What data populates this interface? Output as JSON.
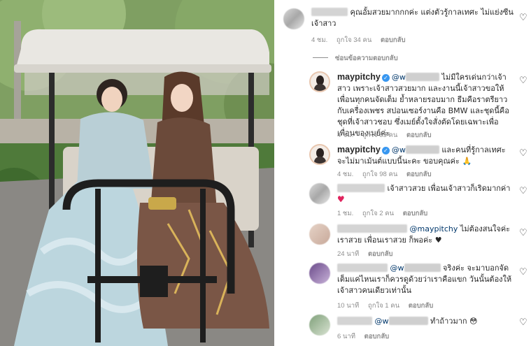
{
  "comments": [
    {
      "id": "c0",
      "username": "w",
      "text": "คุณอั้มสวยมากกกค่ะ แต่งตัวรู้กาลเทศะ ไม่แย่งซีนเจ้าสาว",
      "time": "4 ชม.",
      "likes": "ถูกใจ 34 คน",
      "reply": "ตอบกลับ"
    },
    {
      "id": "c1",
      "username": "maypitchy",
      "mention": "@w",
      "text": "ไม่มีใครเด่นกว่าเจ้าสาว เพราะเจ้าสาวสวยมาก และงานนี้เจ้าสาวขอให้เพื่อนทุกคนจัดเต็ม ย้ำหลายรอบมาก ธีมคือราตรียาวกับเครื่องเพชร สปอนเซอร์งานคือ BMW และชุดนี้คือชุดที่เจ้าสาวชอบ ซึ่งเมย์ตั้งใจสั่งตัดโดยเฉพาะเพื่อเพื่อนของเมย์ค่ะ",
      "time": "4 ชม.",
      "likes": "ถูกใจ 85 คน",
      "reply": "ตอบกลับ"
    },
    {
      "id": "c2",
      "username": "maypitchy",
      "mention": "@w",
      "text": "และคนที่รู้กาลเทศะ จะไม่มาเม้นต์แบบนี้นะคะ ขอบคุณค่ะ 🙏",
      "time": "4 ชม.",
      "likes": "ถูกใจ 98 คน",
      "reply": "ตอบกลับ"
    },
    {
      "id": "c3",
      "text": "เจ้าสาวสวย เพื่อนเจ้าสาวก็เริดมากค่า",
      "emoji": "♥",
      "time": "1 ชม.",
      "likes": "ถูกใจ 2 คน",
      "reply": "ตอบกลับ"
    },
    {
      "id": "c4",
      "mention": "@maypitchy",
      "text": "ไม่ต้องสนใจค่ะ เราสวย เพื่อนเราสวย ก็พอค่ะ ♥",
      "time": "24 นาที",
      "reply": "ตอบกลับ"
    },
    {
      "id": "c5",
      "mention": "@w",
      "text": "จริงค่ะ จะมาบอกจัดเต็มแค่ไหนเราก็ควรดูด้วยว่าเราคือแขก วันนั้นต้องให้เจ้าสาวคนเดียวเท่านั้น",
      "time": "10 นาที",
      "likes": "ถูกใจ 1 คน",
      "reply": "ตอบกลับ"
    },
    {
      "id": "c6",
      "mention": "@w",
      "text": "ทำถ้าวมาก 😳",
      "time": "6 นาที",
      "reply": "ตอบกลับ"
    }
  ],
  "hide_replies": "ซ่อนข้อความตอบกลับ",
  "icons": {
    "like": "heart-outline-icon",
    "verified": "verified-badge-icon"
  },
  "colors": {
    "mention": "#00376b",
    "meta": "#8e8e8e",
    "verified": "#3897f0",
    "heart_red": "#e0245e"
  }
}
